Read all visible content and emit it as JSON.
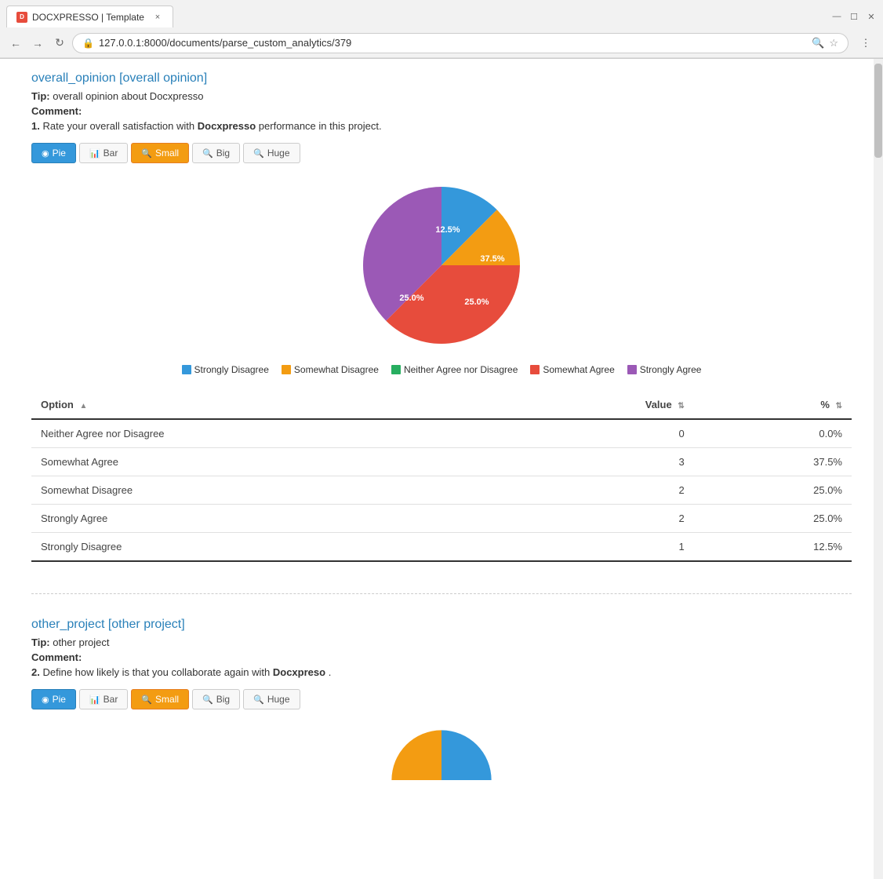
{
  "browser": {
    "tab_title": "DOCXPRESSO | Template",
    "favicon_text": "D",
    "url": "127.0.0.1:8000/documents/parse_custom_analytics/379",
    "close_icon": "×",
    "back_icon": "←",
    "forward_icon": "→",
    "refresh_icon": "↻"
  },
  "section1": {
    "title": "overall_opinion [overall opinion]",
    "tip_label": "Tip:",
    "tip_text": "overall opinion about Docxpresso",
    "comment_label": "Comment:",
    "question_number": "1.",
    "question_text": "Rate your overall satisfaction with",
    "question_bold": "Docxpresso",
    "question_suffix": " performance in this project.",
    "btn_pie": "Pie",
    "btn_bar": "Bar",
    "btn_small": "Small",
    "btn_big": "Big",
    "btn_huge": "Huge",
    "pie_data": [
      {
        "label": "Strongly Disagree",
        "value": 12.5,
        "color": "#3498db"
      },
      {
        "label": "Somewhat Disagree",
        "value": 25.0,
        "color": "#f39c12"
      },
      {
        "label": "Neither Agree nor Disagree",
        "value": 0.0,
        "color": "#27ae60"
      },
      {
        "label": "Somewhat Agree",
        "value": 37.5,
        "color": "#e74c3c"
      },
      {
        "label": "Strongly Agree",
        "value": 25.0,
        "color": "#9b59b6"
      }
    ],
    "table_headers": [
      "Option",
      "Value",
      "%"
    ],
    "table_rows": [
      {
        "option": "Neither Agree nor Disagree",
        "value": "0",
        "percent": "0.0%"
      },
      {
        "option": "Somewhat Agree",
        "value": "3",
        "percent": "37.5%"
      },
      {
        "option": "Somewhat Disagree",
        "value": "2",
        "percent": "25.0%"
      },
      {
        "option": "Strongly Agree",
        "value": "2",
        "percent": "25.0%"
      },
      {
        "option": "Strongly Disagree",
        "value": "1",
        "percent": "12.5%"
      }
    ]
  },
  "section2": {
    "title": "other_project [other project]",
    "tip_label": "Tip:",
    "tip_text": "other project",
    "comment_label": "Comment:",
    "question_number": "2.",
    "question_text": "Define how likely is that you collaborate again with",
    "question_bold": "Docxpreso",
    "question_suffix": ".",
    "btn_pie": "Pie",
    "btn_bar": "Bar",
    "btn_small": "Small",
    "btn_big": "Big",
    "btn_huge": "Huge"
  }
}
